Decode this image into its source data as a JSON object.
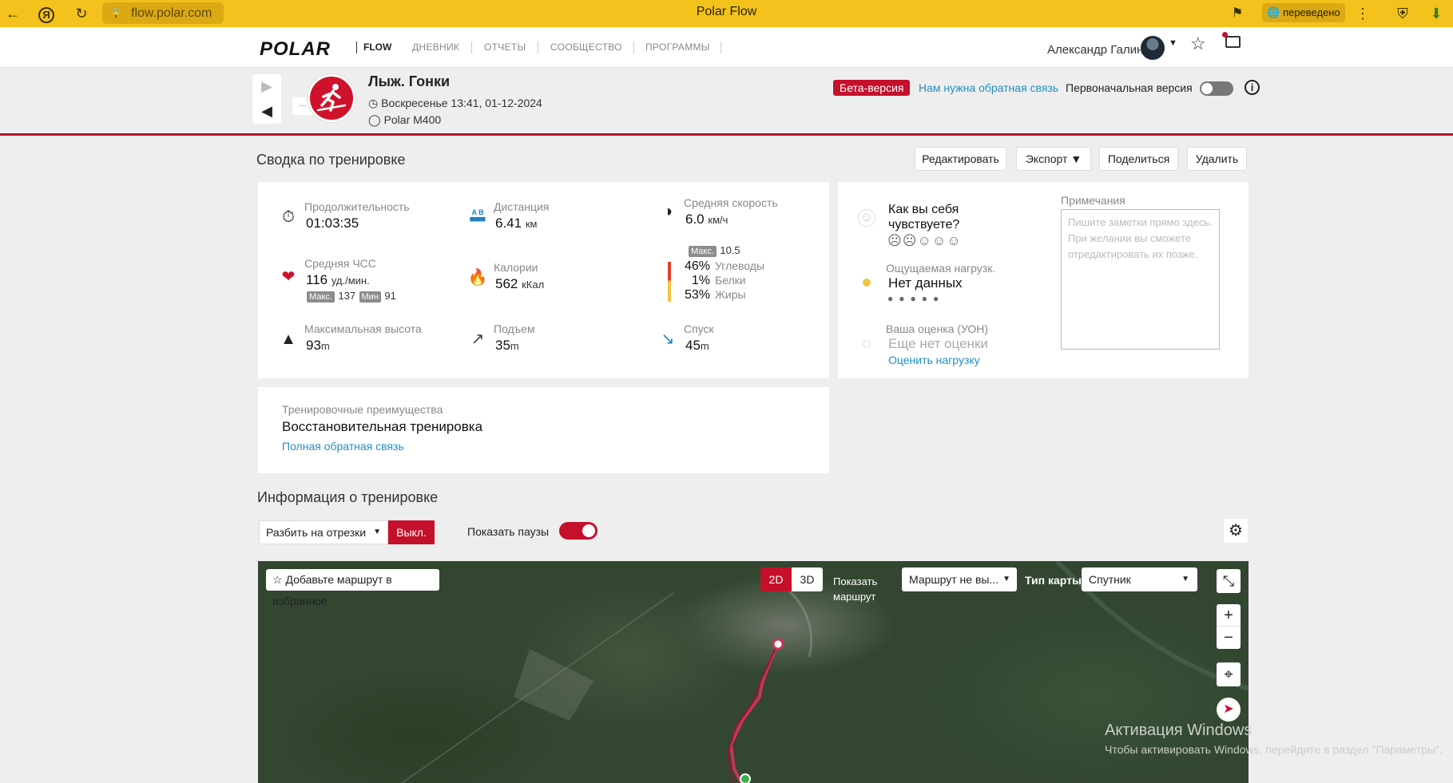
{
  "browser": {
    "url": "flow.polar.com",
    "tab_title": "Polar Flow",
    "translated_badge": "переведено",
    "back_icon": "arrow-left-icon",
    "yandex_icon": "yandex-icon",
    "reload_icon": "reload-icon"
  },
  "nav": {
    "logo": "POLAR",
    "flow": "FLOW",
    "links": [
      "ДНЕВНИК",
      "ОТЧЕТЫ",
      "СООБЩЕСТВО",
      "ПРОГРАММЫ"
    ],
    "user_name": "Александр Галин"
  },
  "activity": {
    "sport": "Лыж. Гонки",
    "date": "Воскресенье 13:41, 01-12-2024",
    "device": "Polar M400",
    "beta": "Бета-версия",
    "feedback_link": "Нам нужна обратная связь",
    "original_version": "Первоначальная версия",
    "original_version_on": false,
    "nav_more": "..."
  },
  "summary": {
    "title": "Сводка по тренировке",
    "buttons": {
      "edit": "Редактировать",
      "export": "Экспорт",
      "share": "Поделиться",
      "delete": "Удалить"
    },
    "duration": {
      "label": "Продолжительность",
      "value": "01:03:35"
    },
    "distance": {
      "label": "Дистанция",
      "value": "6.41",
      "unit": "км",
      "icon_text": "A B"
    },
    "avg_speed": {
      "label": "Средняя скорость",
      "value": "6.0",
      "unit": "км/ч",
      "max_label": "Макс.",
      "max_value": "10.5"
    },
    "avg_hr": {
      "label": "Средняя ЧСС",
      "value": "116",
      "unit": "уд./мин.",
      "max_label": "Макс.",
      "max_value": "137",
      "min_label": "Мин",
      "min_value": "91"
    },
    "calories": {
      "label": "Калории",
      "value": "562",
      "unit": "кКал"
    },
    "macros": {
      "carbs": {
        "pct": "46%",
        "label": "Углеводы"
      },
      "protein": {
        "pct": "1%",
        "label": "Белки"
      },
      "fat": {
        "pct": "53%",
        "label": "Жиры"
      }
    },
    "max_alt": {
      "label": "Максимальная высота",
      "value": "93",
      "unit": "m"
    },
    "ascent": {
      "label": "Подъем",
      "value": "35",
      "unit": "m"
    },
    "descent": {
      "label": "Спуск",
      "value": "45",
      "unit": "m"
    }
  },
  "feel": {
    "question": "Как вы себя чувствуете?",
    "perceived_label": "Ощущаемая нагрузк.",
    "perceived_value": "Нет данных",
    "rpe_label": "Ваша оценка (УОН)",
    "rpe_value": "Еще нет оценки",
    "rpe_link": "Оценить нагрузку",
    "notes_label": "Примечания",
    "notes_placeholder": "Пишите заметки прямо здесь. При желании вы сможете отредактировать их позже."
  },
  "benefit": {
    "label": "Тренировочные преимущества",
    "value": "Восстановительная тренировка",
    "link": "Полная обратная связь"
  },
  "info": {
    "title": "Информация о тренировке",
    "split_select": "Разбить на отрезки",
    "off_button": "Выкл.",
    "show_pauses": "Показать паузы",
    "show_pauses_on": true
  },
  "map": {
    "favorite": "Добавьте маршрут в избранное",
    "mode_2d": "2D",
    "mode_3d": "3D",
    "show_route": "Показать маршрут",
    "route_select": "Маршрут не вы...",
    "map_type_label": "Тип карты",
    "map_type_value": "Спутник",
    "zoom_in": "+",
    "zoom_out": "−"
  },
  "windows": {
    "line1": "Активация Windows",
    "line2": "Чтобы активировать Windows, перейдите в раздел \"Параметры\"."
  },
  "colors": {
    "brand_red": "#c4102b",
    "browser_yellow": "#f4c21c",
    "link_blue": "#1f8fc2"
  }
}
